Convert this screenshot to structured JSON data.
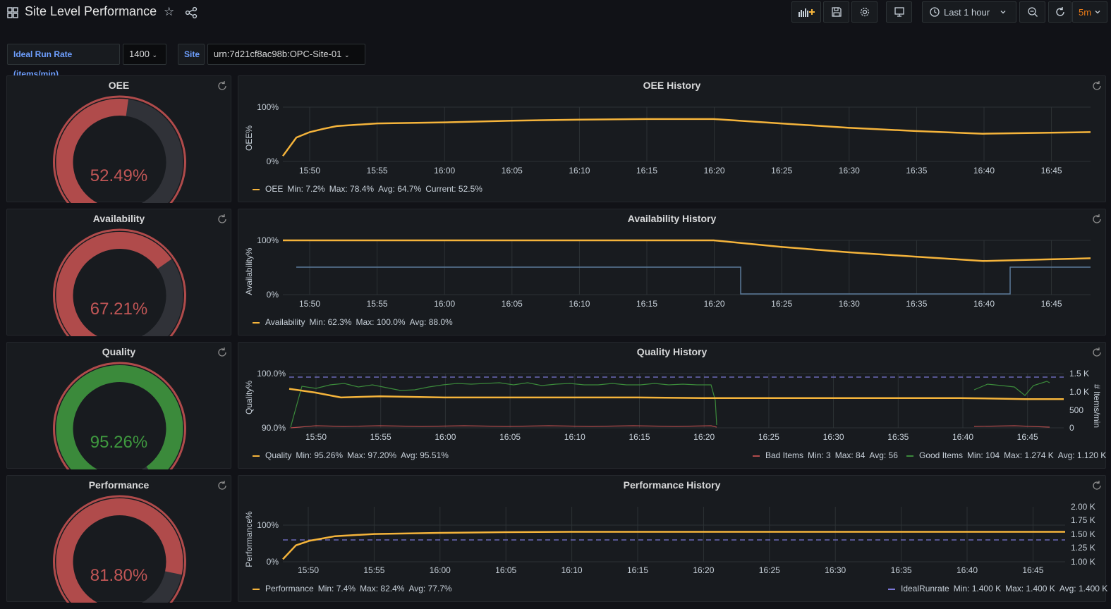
{
  "header": {
    "title": "Site Level Performance",
    "time_range": "Last 1 hour",
    "refresh_interval": "5m"
  },
  "variables": [
    {
      "label": "Ideal Run Rate (items/min)",
      "value": "1400"
    },
    {
      "label": "Site",
      "value": "urn:7d21cf8ac98b:OPC-Site-01"
    }
  ],
  "colors": {
    "accent": "#f5b43b",
    "red": "#b04b4b",
    "green": "#3b8a3b",
    "blue_line": "#5a7a9a",
    "purple_dash": "#7c78d8"
  },
  "gauges": [
    {
      "title": "OEE",
      "value_text": "52.49%",
      "value": 52.49,
      "status": "bad"
    },
    {
      "title": "Availability",
      "value_text": "67.21%",
      "value": 67.21,
      "status": "bad"
    },
    {
      "title": "Quality",
      "value_text": "95.26%",
      "value": 95.26,
      "status": "good"
    },
    {
      "title": "Performance",
      "value_text": "81.80%",
      "value": 81.8,
      "status": "bad"
    }
  ],
  "time_ticks": [
    "15:50",
    "15:55",
    "16:00",
    "16:05",
    "16:10",
    "16:15",
    "16:20",
    "16:25",
    "16:30",
    "16:35",
    "16:40",
    "16:45"
  ],
  "charts": {
    "oee": {
      "title": "OEE History",
      "ylabel": "OEE%",
      "yticks": [
        "100%",
        "0%"
      ],
      "legend_left": {
        "name": "OEE",
        "stats": [
          "Min: 7.2%",
          "Max: 78.4%",
          "Avg: 64.7%",
          "Current: 52.5%"
        ]
      }
    },
    "availability": {
      "title": "Availability History",
      "ylabel": "Availability%",
      "yticks": [
        "100%",
        "0%"
      ],
      "legend_left": {
        "name": "Availability",
        "stats": [
          "Min: 62.3%",
          "Max: 100.0%",
          "Avg: 88.0%"
        ]
      }
    },
    "quality": {
      "title": "Quality History",
      "ylabel": "Quality%",
      "y2label": "# Items/min",
      "yticks": [
        "100.0%",
        "90.0%"
      ],
      "y2ticks": [
        "1.5 K",
        "1.0 K",
        "500",
        "0"
      ],
      "legend_left": {
        "name": "Quality",
        "stats": [
          "Min: 95.26%",
          "Max: 97.20%",
          "Avg: 95.51%"
        ]
      },
      "legend_bad": {
        "name": "Bad Items",
        "stats": [
          "Min: 3",
          "Max: 84",
          "Avg: 56"
        ]
      },
      "legend_good": {
        "name": "Good Items",
        "stats": [
          "Min: 104",
          "Max: 1.274 K",
          "Avg: 1.120 K"
        ]
      }
    },
    "performance": {
      "title": "Performance History",
      "ylabel": "Performance%",
      "yticks": [
        "100%",
        "0%"
      ],
      "y2ticks": [
        "2.00 K",
        "1.75 K",
        "1.50 K",
        "1.25 K",
        "1.00 K"
      ],
      "legend_left": {
        "name": "Performance",
        "stats": [
          "Min: 7.4%",
          "Max: 82.4%",
          "Avg: 77.7%"
        ]
      },
      "legend_right": {
        "name": "IdealRunrate",
        "stats": [
          "Min: 1.400 K",
          "Max: 1.400 K",
          "Avg: 1.400 K"
        ]
      }
    }
  },
  "chart_data": [
    {
      "type": "line",
      "title": "OEE History",
      "ylabel": "OEE%",
      "ylim": [
        0,
        100
      ],
      "series": [
        {
          "name": "OEE",
          "x": [
            "15:48",
            "15:49",
            "15:50",
            "15:51",
            "15:52",
            "15:55",
            "16:00",
            "16:05",
            "16:10",
            "16:15",
            "16:20",
            "16:25",
            "16:30",
            "16:35",
            "16:40",
            "16:45",
            "16:48"
          ],
          "values": [
            10,
            44,
            54,
            60,
            65,
            70,
            72,
            75,
            77,
            78,
            78,
            70,
            62,
            56,
            51,
            53,
            54
          ]
        }
      ]
    },
    {
      "type": "line",
      "title": "Availability History",
      "ylabel": "Availability%",
      "ylim": [
        0,
        100
      ],
      "series": [
        {
          "name": "Availability",
          "x": [
            "15:48",
            "15:55",
            "16:00",
            "16:05",
            "16:10",
            "16:15",
            "16:20",
            "16:25",
            "16:30",
            "16:35",
            "16:40",
            "16:45",
            "16:48"
          ],
          "values": [
            100,
            100,
            100,
            100,
            100,
            100,
            100,
            88,
            78,
            70,
            62,
            65,
            67
          ]
        }
      ]
    },
    {
      "type": "line",
      "title": "Quality History",
      "ylabel": "Quality%",
      "ylim": [
        90,
        100
      ],
      "series": [
        {
          "name": "Quality",
          "x": [
            "15:48",
            "15:50",
            "15:52",
            "15:55",
            "16:00",
            "16:05",
            "16:10",
            "16:15",
            "16:20",
            "16:25",
            "16:30",
            "16:35",
            "16:40",
            "16:45",
            "16:48"
          ],
          "values": [
            97.2,
            96.5,
            95.6,
            95.8,
            95.6,
            95.6,
            95.6,
            95.6,
            95.5,
            95.5,
            95.5,
            95.5,
            95.5,
            95.3,
            95.3
          ]
        }
      ]
    },
    {
      "type": "line",
      "title": "Performance History",
      "ylabel": "Performance%",
      "ylim": [
        0,
        160
      ],
      "series": [
        {
          "name": "Performance",
          "x": [
            "15:48",
            "15:49",
            "15:50",
            "15:52",
            "15:55",
            "16:00",
            "16:05",
            "16:10",
            "16:15",
            "16:20",
            "16:30",
            "16:40",
            "16:48"
          ],
          "values": [
            7,
            45,
            57,
            70,
            76,
            79,
            81,
            82,
            82,
            82,
            82,
            82,
            82
          ]
        },
        {
          "name": "IdealRunrate",
          "x": [
            "15:48",
            "16:48"
          ],
          "values": [
            1400,
            1400
          ]
        }
      ]
    }
  ]
}
